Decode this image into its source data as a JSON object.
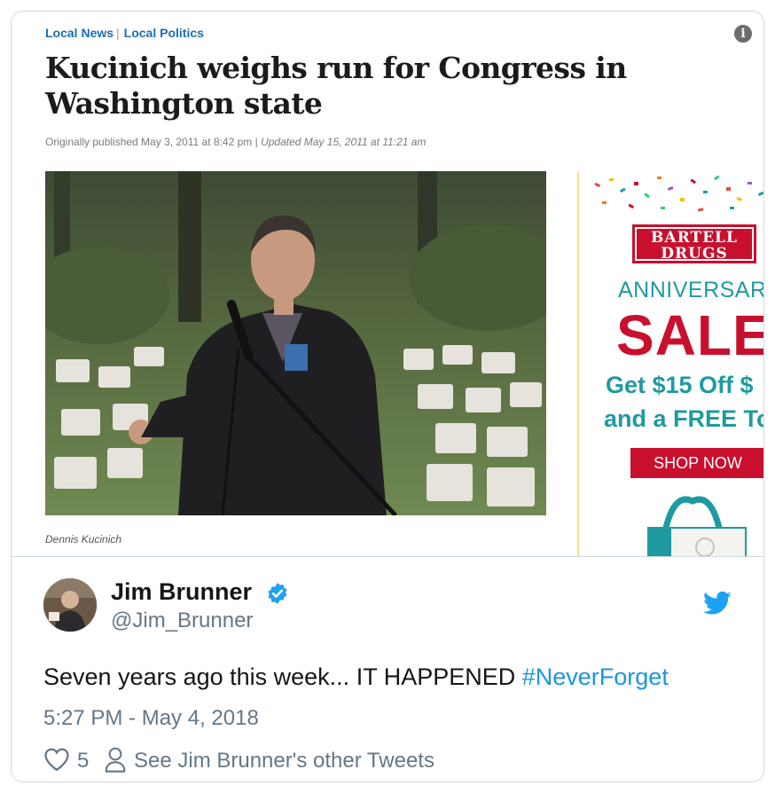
{
  "article": {
    "categories": [
      "Local News",
      "Local Politics"
    ],
    "headline": "Kucinich weighs run for Congress in Washington state",
    "published": "Originally published May 3, 2011 at 8:42 pm",
    "separator": "|",
    "updated": "Updated May 15, 2011 at 11:21 am",
    "caption": "Dennis Kucinich",
    "info_icon": "info-icon"
  },
  "ad": {
    "brand_line1": "BARTELL",
    "brand_line2": "DRUGS",
    "anniversary": "ANNIVERSAR",
    "sale": "SALE",
    "offer_line1": "Get $15 Off $",
    "offer_line2": "and a FREE To",
    "cta": "SHOP NOW",
    "colors": {
      "red": "#c8102e",
      "teal": "#1f9aa0",
      "border": "#f2e08a"
    }
  },
  "tweet": {
    "name": "Jim Brunner",
    "handle": "@Jim_Brunner",
    "text": "Seven years ago this week... IT HAPPENED ",
    "hashtag": "#NeverForget",
    "timestamp": "5:27 PM - May 4, 2018",
    "likes": "5",
    "see_more": "See Jim Brunner's other Tweets",
    "colors": {
      "link": "#1b95e0",
      "muted": "#657786"
    }
  }
}
